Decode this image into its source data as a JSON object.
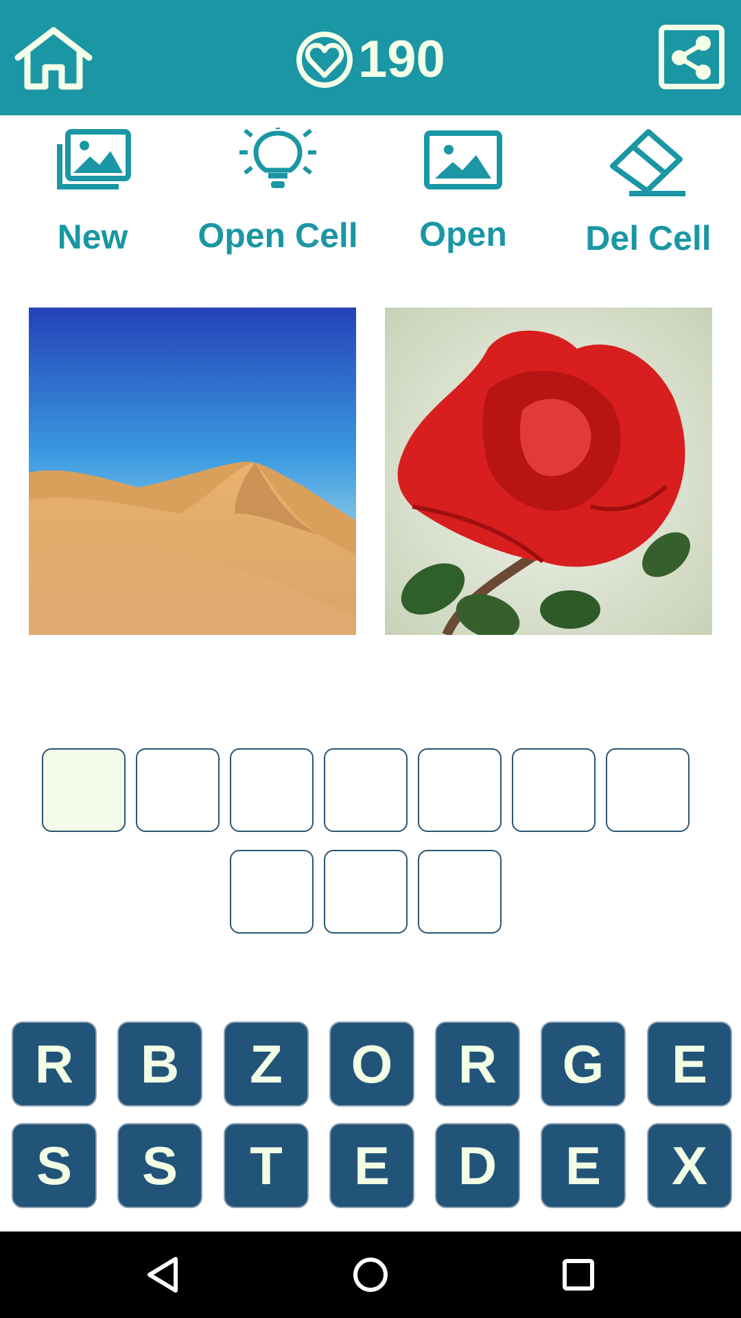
{
  "header": {
    "score": "190",
    "home_icon": "home-icon",
    "heart_icon": "heart-icon",
    "share_icon": "share-icon",
    "bar_color": "#1a96a4"
  },
  "tools": {
    "new_label": "New",
    "open_cell_label": "Open Cell",
    "open_label": "Open",
    "del_cell_label": "Del Cell",
    "color": "#1a96a4"
  },
  "pictures": [
    {
      "subject": "desert-dunes"
    },
    {
      "subject": "red-rose"
    }
  ],
  "answer": {
    "row1_cells": 7,
    "row2_cells": 3,
    "active_cell_index": 0
  },
  "keyboard": {
    "row1": [
      "R",
      "B",
      "Z",
      "O",
      "R",
      "G",
      "E"
    ],
    "row2": [
      "S",
      "S",
      "T",
      "E",
      "D",
      "E",
      "X"
    ],
    "key_color": "#22547a"
  },
  "navbar": {
    "back_icon": "back-icon",
    "home_icon": "nav-home-icon",
    "recents_icon": "recents-icon"
  }
}
